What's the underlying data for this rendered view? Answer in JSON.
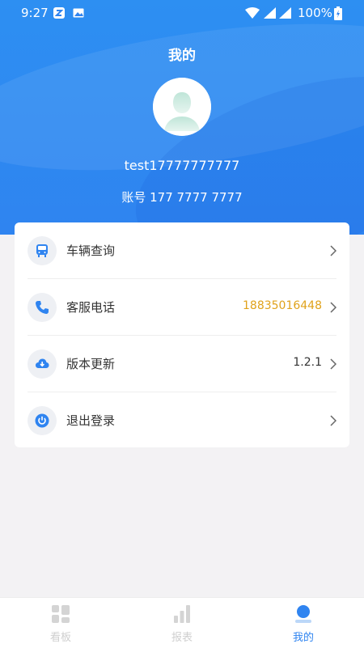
{
  "status_bar": {
    "time": "9:27",
    "battery": "100%"
  },
  "header": {
    "title": "我的",
    "username": "test17777777777",
    "account": "账号 177 7777 7777"
  },
  "colors": {
    "primary": "#2f84f0",
    "accent_value": "#e0a21b"
  },
  "menu": {
    "items": [
      {
        "label": "车辆查询",
        "value": "",
        "icon": "bus-icon"
      },
      {
        "label": "客服电话",
        "value": "18835016448",
        "icon": "phone-icon"
      },
      {
        "label": "版本更新",
        "value": "1.2.1",
        "icon": "cloud-download-icon"
      },
      {
        "label": "退出登录",
        "value": "",
        "icon": "power-icon"
      }
    ]
  },
  "tabbar": {
    "tabs": [
      {
        "label": "看板",
        "icon": "dashboard-icon",
        "active": false
      },
      {
        "label": "报表",
        "icon": "bar-chart-icon",
        "active": false
      },
      {
        "label": "我的",
        "icon": "person-icon",
        "active": true
      }
    ]
  }
}
